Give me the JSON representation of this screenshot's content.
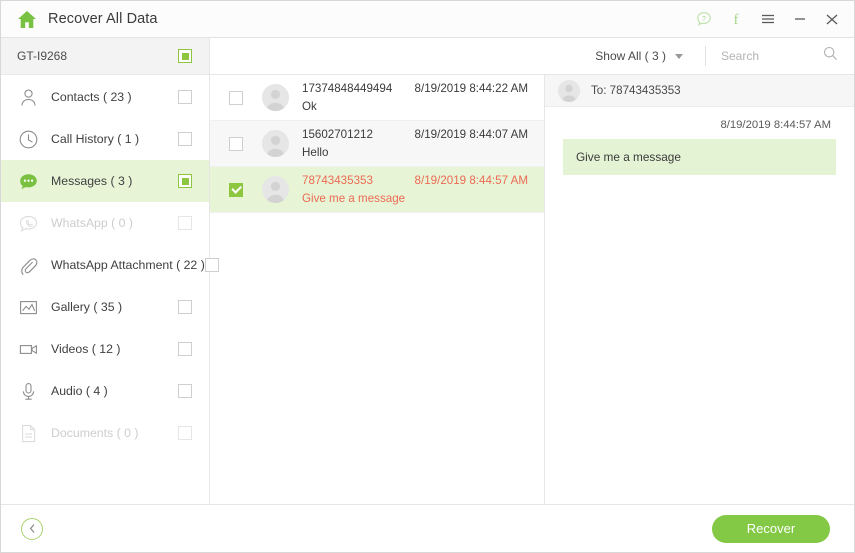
{
  "window": {
    "title": "Recover All Data",
    "home_icon": "home-icon",
    "controls": [
      {
        "name": "help-icon",
        "label": "?"
      },
      {
        "name": "facebook-icon",
        "label": "f"
      },
      {
        "name": "menu-icon",
        "label": "≡"
      },
      {
        "name": "minimize-icon",
        "label": "−"
      },
      {
        "name": "close-icon",
        "label": "×"
      }
    ]
  },
  "sidebar": {
    "device": {
      "name": "GT-I9268",
      "checkbox": "partial"
    },
    "items": [
      {
        "label": "Contacts ( 23 )",
        "icon": "person-icon",
        "checkbox": "unchecked",
        "state": "normal",
        "active": false
      },
      {
        "label": "Call History ( 1 )",
        "icon": "clock-icon",
        "checkbox": "unchecked",
        "state": "normal",
        "active": false
      },
      {
        "label": "Messages ( 3 )",
        "icon": "message-icon",
        "checkbox": "partial",
        "state": "normal",
        "active": true
      },
      {
        "label": "WhatsApp ( 0 )",
        "icon": "whatsapp-icon",
        "checkbox": "unchecked",
        "state": "disabled",
        "active": false
      },
      {
        "label": "WhatsApp Attachment ( 22 )",
        "icon": "paperclip-icon",
        "checkbox": "unchecked",
        "state": "normal",
        "active": false
      },
      {
        "label": "Gallery ( 35 )",
        "icon": "image-icon",
        "checkbox": "unchecked",
        "state": "normal",
        "active": false
      },
      {
        "label": "Videos ( 12 )",
        "icon": "video-icon",
        "checkbox": "unchecked",
        "state": "normal",
        "active": false
      },
      {
        "label": "Audio ( 4 )",
        "icon": "microphone-icon",
        "checkbox": "unchecked",
        "state": "normal",
        "active": false
      },
      {
        "label": "Documents ( 0 )",
        "icon": "document-icon",
        "checkbox": "unchecked",
        "state": "disabled",
        "active": false
      }
    ]
  },
  "toolbar": {
    "show_all_label": "Show All ( 3 )",
    "search_placeholder": "Search",
    "search_value": ""
  },
  "message_list": [
    {
      "number": "17374848449494",
      "preview": "Ok",
      "time": "8/19/2019 8:44:22 AM",
      "checked": false,
      "selected": false,
      "alt": false
    },
    {
      "number": "15602701212",
      "preview": "Hello",
      "time": "8/19/2019 8:44:07 AM",
      "checked": false,
      "selected": false,
      "alt": true
    },
    {
      "number": "78743435353",
      "preview": "Give me a message",
      "time": "8/19/2019 8:44:57 AM",
      "checked": true,
      "selected": true,
      "alt": false
    }
  ],
  "detail": {
    "to_label": "To: 78743435353",
    "messages": [
      {
        "time": "8/19/2019 8:44:57 AM",
        "text": "Give me a message"
      }
    ]
  },
  "footer": {
    "back_icon": "chevron-left-icon",
    "recover_label": "Recover"
  },
  "colors": {
    "accent_green": "#83c945",
    "light_green_row": "#e7f5d6",
    "bubble_green": "#e3f3d4",
    "selected_text": "#ec6a53",
    "checkbox_green": "#8dc63f"
  }
}
